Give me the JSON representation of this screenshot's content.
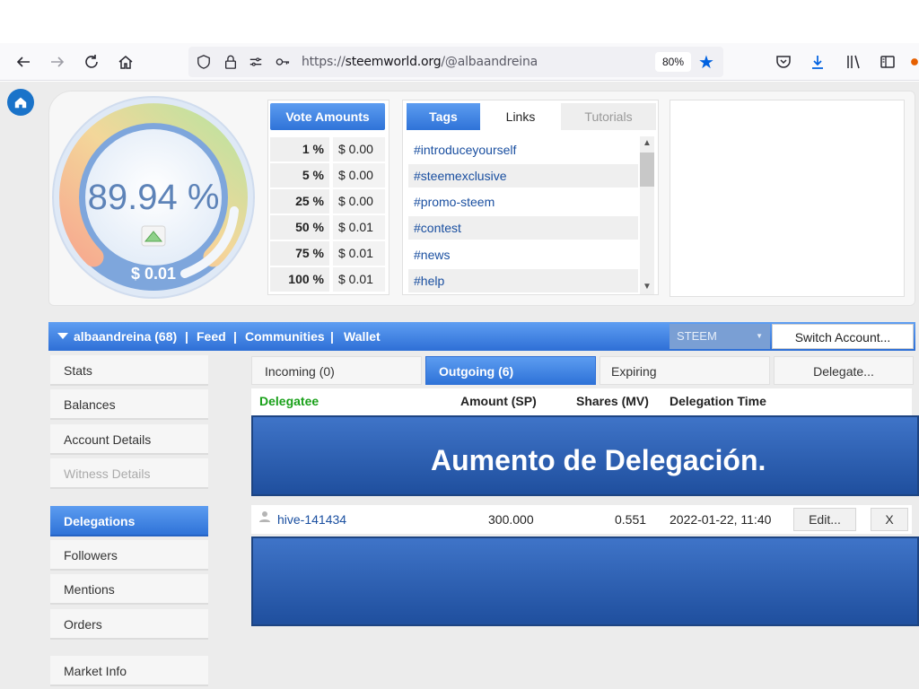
{
  "browser": {
    "url_prefix": "https://",
    "url_host": "steemworld.org",
    "url_path": "/@albaandreina",
    "zoom": "80%"
  },
  "gauge": {
    "percent": "89.94 %",
    "value": "$ 0.01",
    "level": 0.8994
  },
  "vote_amounts": {
    "title": "Vote Amounts",
    "rows": [
      {
        "pct": "1 %",
        "val": "$ 0.00"
      },
      {
        "pct": "5 %",
        "val": "$ 0.00"
      },
      {
        "pct": "25 %",
        "val": "$ 0.00"
      },
      {
        "pct": "50 %",
        "val": "$ 0.01"
      },
      {
        "pct": "75 %",
        "val": "$ 0.01"
      },
      {
        "pct": "100 %",
        "val": "$ 0.01"
      }
    ]
  },
  "tags_panel": {
    "tabs": [
      "Tags",
      "Links",
      "Tutorials"
    ],
    "tags": [
      "#introduceyourself",
      "#steemexclusive",
      "#promo-steem",
      "#contest",
      "#news",
      "#help"
    ]
  },
  "account_bar": {
    "account": "albaandreina (68)",
    "sep": "|",
    "feed": "Feed",
    "communities": "Communities",
    "wallet": "Wallet",
    "currency": "STEEM",
    "switch": "Switch Account..."
  },
  "sidebar": {
    "items": [
      "Stats",
      "Balances",
      "Account Details",
      "Witness Details",
      "Delegations",
      "Followers",
      "Mentions",
      "Orders",
      "Market Info"
    ]
  },
  "delegations": {
    "tabs": [
      "Incoming (0)",
      "Outgoing (6)",
      "Expiring",
      "Delegate..."
    ],
    "headers": [
      "Delegatee",
      "Amount (SP)",
      "Shares (MV)",
      "Delegation Time"
    ],
    "banner": "Aumento de Delegación.",
    "row": {
      "delegatee": "hive-141434",
      "amount": "300.000",
      "shares": "0.551",
      "time": "2022-01-22, 11:40",
      "edit": "Edit...",
      "remove": "X"
    }
  },
  "colors": {
    "accent": "#2f73d8",
    "green_header": "#19a019",
    "link": "#1a4fa0"
  }
}
